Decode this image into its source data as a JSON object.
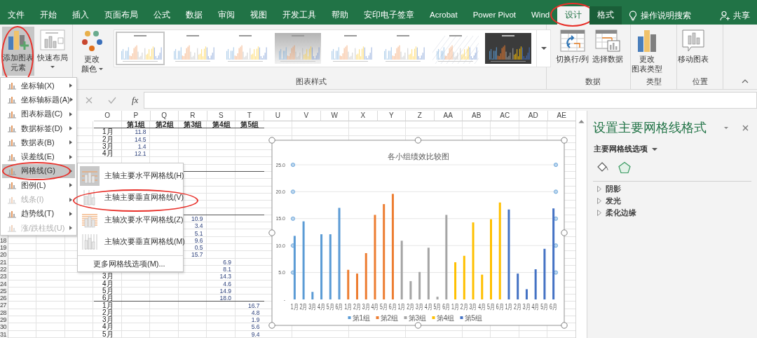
{
  "tabs": [
    {
      "label": "文件",
      "selected": false,
      "contextual": false
    },
    {
      "label": "开始",
      "selected": false,
      "contextual": false
    },
    {
      "label": "插入",
      "selected": false,
      "contextual": false
    },
    {
      "label": "页面布局",
      "selected": false,
      "contextual": false
    },
    {
      "label": "公式",
      "selected": false,
      "contextual": false
    },
    {
      "label": "数据",
      "selected": false,
      "contextual": false
    },
    {
      "label": "审阅",
      "selected": false,
      "contextual": false
    },
    {
      "label": "视图",
      "selected": false,
      "contextual": false
    },
    {
      "label": "开发工具",
      "selected": false,
      "contextual": false
    },
    {
      "label": "帮助",
      "selected": false,
      "contextual": false
    },
    {
      "label": "安印电子签章",
      "selected": false,
      "contextual": false
    },
    {
      "label": "Acrobat",
      "selected": false,
      "contextual": false
    },
    {
      "label": "Power Pivot",
      "selected": false,
      "contextual": false
    },
    {
      "label": "Wind",
      "selected": false,
      "contextual": false
    },
    {
      "label": "设计",
      "selected": true,
      "contextual": true,
      "circled": true
    },
    {
      "label": "格式",
      "selected": false,
      "contextual": true
    }
  ],
  "tell_me": {
    "label": "操作说明搜索"
  },
  "share": {
    "label": "共享"
  },
  "ribbon": {
    "add_element": {
      "label_lines": [
        "添加图表",
        "元素"
      ],
      "pressed": true,
      "circled": true
    },
    "quick_layout": {
      "label": "快速布局"
    },
    "change_colors": {
      "label_lines": [
        "更改",
        "颜色"
      ]
    },
    "chart_styles": [
      {
        "kind": "light",
        "selected": true
      },
      {
        "kind": "light",
        "selected": false
      },
      {
        "kind": "light",
        "selected": false
      },
      {
        "kind": "gray",
        "selected": false
      },
      {
        "kind": "light",
        "selected": false
      },
      {
        "kind": "light",
        "selected": false
      },
      {
        "kind": "hatched",
        "selected": false
      },
      {
        "kind": "dark",
        "selected": false
      }
    ],
    "styles_group": "图表样式",
    "data_buttons": [
      {
        "label": "切换行/列",
        "kind": "switch"
      },
      {
        "label": "选择数据",
        "kind": "select"
      }
    ],
    "data_group": "数据",
    "change_type": {
      "label_lines": [
        "更改",
        "图表类型"
      ]
    },
    "type_group": "类型",
    "move_chart": {
      "label": "移动图表"
    },
    "location_group": "位置"
  },
  "formula_bar": {
    "function_label": "fx"
  },
  "sheet": {
    "columns": [
      "O",
      "P",
      "Q",
      "R",
      "S",
      "T",
      "U",
      "V",
      "W",
      "X",
      "Y",
      "Z",
      "AA",
      "AB",
      "AC",
      "AD",
      "AE"
    ],
    "rows": [
      {
        "kind": "header",
        "rule_below": true,
        "cells": {
          "P": "第1组",
          "Q": "第2组",
          "R": "第3组",
          "S": "第4组",
          "T": "第5组"
        }
      },
      {
        "cells": {
          "O": "1月",
          "P": "11.8"
        }
      },
      {
        "cells": {
          "O": "2月",
          "P": "14.5"
        }
      },
      {
        "cells": {
          "O": "3月",
          "P": "1.4"
        }
      },
      {
        "cells": {
          "O": "4月",
          "P": "12.1"
        }
      },
      {},
      {
        "rule_below": true
      },
      {},
      {},
      {},
      {},
      {},
      {
        "rule_below": true
      },
      {
        "cells": {
          "R": "10.9"
        }
      },
      {
        "cells": {
          "R": "3.4"
        }
      },
      {
        "cells": {
          "R": "5.1"
        }
      },
      {
        "number": "18",
        "cells": {
          "R": "9.6"
        }
      },
      {
        "number": "19",
        "cells": {
          "R": "0.5"
        }
      },
      {
        "number": "20",
        "cells": {
          "R": "15.7"
        }
      },
      {
        "number": "21",
        "cells": {
          "S": "6.9"
        }
      },
      {
        "number": "22",
        "cells": {
          "S": "8.1"
        }
      },
      {
        "number": "23",
        "cells": {
          "O": "3月",
          "S": "14.3"
        }
      },
      {
        "number": "24",
        "cells": {
          "O": "4月",
          "S": "4.6"
        }
      },
      {
        "number": "25",
        "cells": {
          "O": "5月",
          "S": "14.9"
        }
      },
      {
        "number": "26",
        "rule_below": true,
        "cells": {
          "O": "6月",
          "S": "18.0"
        }
      },
      {
        "number": "27",
        "cells": {
          "O": "1月",
          "T": "16.7"
        }
      },
      {
        "number": "28",
        "cells": {
          "O": "2月",
          "T": "4.8"
        }
      },
      {
        "number": "29",
        "cells": {
          "O": "3月",
          "T": "1.9"
        }
      },
      {
        "number": "30",
        "cells": {
          "O": "4月",
          "T": "5.6"
        }
      },
      {
        "number": "31",
        "cells": {
          "O": "5月",
          "T": "9.4"
        }
      }
    ]
  },
  "chart": {
    "gridlines_selected": true,
    "chart_data": {
      "type": "bar",
      "title": "各小组绩效比较图",
      "grid": true,
      "legend": true,
      "categories": [
        "1月",
        "2月",
        "3月",
        "4月",
        "5月",
        "6月",
        "1月",
        "2月",
        "3月",
        "4月",
        "5月",
        "6月",
        "1月",
        "2月",
        "3月",
        "4月",
        "5月",
        "6月",
        "1月",
        "2月",
        "3月",
        "4月",
        "5月",
        "6月",
        "1月",
        "2月",
        "3月",
        "4月",
        "5月",
        "6月"
      ],
      "series": [
        {
          "name": "第1组",
          "color": "#5b9bd5",
          "values": [
            11.8,
            14.5,
            1.4,
            12.1,
            12.1,
            17.0,
            null,
            null,
            null,
            null,
            null,
            null,
            null,
            null,
            null,
            null,
            null,
            null,
            null,
            null,
            null,
            null,
            null,
            null,
            null,
            null,
            null,
            null,
            null,
            null
          ]
        },
        {
          "name": "第2组",
          "color": "#ed7d31",
          "values": [
            null,
            null,
            null,
            null,
            null,
            null,
            5.5,
            4.8,
            8.6,
            15.7,
            17.7,
            19.6,
            null,
            null,
            null,
            null,
            null,
            null,
            null,
            null,
            null,
            null,
            null,
            null,
            null,
            null,
            null,
            null,
            null,
            null
          ]
        },
        {
          "name": "第3组",
          "color": "#a5a5a5",
          "values": [
            null,
            null,
            null,
            null,
            null,
            null,
            null,
            null,
            null,
            null,
            null,
            null,
            10.9,
            3.4,
            5.1,
            9.6,
            0.5,
            15.7,
            null,
            null,
            null,
            null,
            null,
            null,
            null,
            null,
            null,
            null,
            null,
            null
          ]
        },
        {
          "name": "第4组",
          "color": "#ffc000",
          "values": [
            null,
            null,
            null,
            null,
            null,
            null,
            null,
            null,
            null,
            null,
            null,
            null,
            null,
            null,
            null,
            null,
            null,
            null,
            6.9,
            8.1,
            14.3,
            4.6,
            14.9,
            18.0,
            null,
            null,
            null,
            null,
            null,
            null
          ]
        },
        {
          "name": "第5组",
          "color": "#4472c4",
          "values": [
            null,
            null,
            null,
            null,
            null,
            null,
            null,
            null,
            null,
            null,
            null,
            null,
            null,
            null,
            null,
            null,
            null,
            null,
            null,
            null,
            null,
            null,
            null,
            null,
            16.7,
            4.8,
            1.9,
            5.6,
            9.4,
            16.9
          ]
        }
      ],
      "ylim": [
        0,
        25
      ],
      "yticks": [
        {
          "value": 0,
          "label": "-"
        },
        {
          "value": 5,
          "label": "5.0"
        },
        {
          "value": 10,
          "label": "10.0"
        },
        {
          "value": 15,
          "label": "15.0"
        },
        {
          "value": 20,
          "label": "20.0"
        },
        {
          "value": 25,
          "label": "25.0"
        }
      ]
    }
  },
  "chart_element_menu": [
    {
      "label": "坐标轴(X)",
      "selected": false,
      "disabled": false
    },
    {
      "label": "坐标轴标题(A)",
      "selected": false,
      "disabled": false
    },
    {
      "label": "图表标题(C)",
      "selected": false,
      "disabled": false
    },
    {
      "label": "数据标签(D)",
      "selected": false,
      "disabled": false
    },
    {
      "label": "数据表(B)",
      "selected": false,
      "disabled": false
    },
    {
      "label": "误差线(E)",
      "selected": false,
      "disabled": false
    },
    {
      "label": "网格线(G)",
      "selected": true,
      "disabled": false,
      "circled": true
    },
    {
      "label": "图例(L)",
      "selected": false,
      "disabled": false
    },
    {
      "label": "线条(I)",
      "selected": false,
      "disabled": true
    },
    {
      "label": "趋势线(T)",
      "selected": false,
      "disabled": false
    },
    {
      "label": "涨/跌柱线(U)",
      "selected": false,
      "disabled": true
    }
  ],
  "gridlines_submenu": {
    "items": [
      {
        "label": "主轴主要水平网格线(H)",
        "kind": "major-horizontal",
        "checked": true
      },
      {
        "label": "主轴主要垂直网格线(V)",
        "kind": "major-vertical",
        "checked": false,
        "circled": true
      },
      {
        "label": "主轴次要水平网格线(Z)",
        "kind": "minor-horizontal",
        "checked": false
      },
      {
        "label": "主轴次要垂直网格线(M)",
        "kind": "minor-vertical",
        "checked": false
      }
    ],
    "more": "更多网格线选项(M)..."
  },
  "format_pane": {
    "title": "设置主要网格线格式",
    "options_label": "主要网格线选项",
    "icon_tabs": [
      {
        "kind": "fill",
        "selected": false
      },
      {
        "kind": "effects",
        "selected": true
      }
    ],
    "sections": [
      {
        "label": "阴影",
        "expanded": false
      },
      {
        "label": "发光",
        "expanded": false
      },
      {
        "label": "柔化边缘",
        "expanded": false
      }
    ]
  }
}
